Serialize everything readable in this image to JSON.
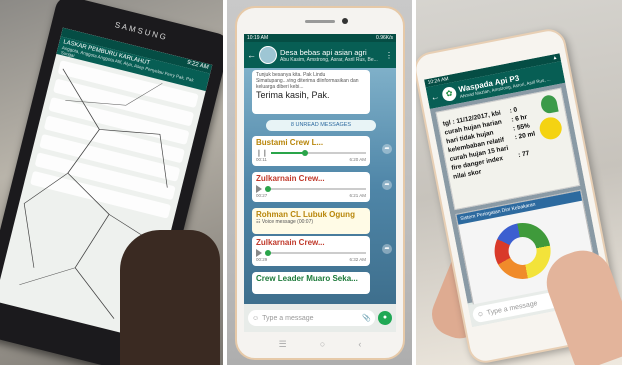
{
  "panel1": {
    "brand": "SAMSUNG",
    "header_title": "LASKAR PEMBURU KARLAHUT",
    "header_sub": "Anggota, Anggota Anggota Afif, Alya, Asep Penyelau Ferry Pak, Pak Sungai",
    "status_time": "9:22 AM"
  },
  "panel2": {
    "status_time": "10:19 AM",
    "status_right": "0.96K/s",
    "header_title": "Desa bebas api asian agri",
    "header_sub": "Abu Kasim, Amstrong, Asrar, Asril Rus, Be...",
    "intro_text": "Tunjuk besanya kita. Pak Lindu Simatupang...ving diterima diinformasikan dan keluarga diberi kebi...",
    "thanks_text": "Terima kasih, Pak.",
    "thanks_time": "12:27 PM",
    "unread": "8 UNREAD MESSAGES",
    "messages": [
      {
        "sender": "Bustami Crew L...",
        "t1": "00:11",
        "t2": "6:20 AM"
      },
      {
        "sender": "Zulkarnain Crew...",
        "t1": "00:27",
        "t2": "6:21 AM"
      },
      {
        "sender": "Rohman CL Lubuk Ogung",
        "text": "☷ Voice message (00:07)"
      },
      {
        "sender": "Zulkarnain Crew...",
        "t1": "00:29",
        "t2": "6:32 AM"
      },
      {
        "sender": "Crew Leader Muaro Seka...",
        "t1": "",
        "t2": ""
      }
    ],
    "input_placeholder": "Type a message"
  },
  "panel3": {
    "status_time": "10:24 AM",
    "header_title": "Waspada Api P3",
    "header_sub": "Ahmad Mazlan, Amstrong, Asrori, Asril Rus, ...",
    "rows": [
      {
        "label": "tgl : 11/12/2017, kbi",
        "value": ": 0"
      },
      {
        "label": "curah hujan harian",
        "value": ": 6 hr"
      },
      {
        "label": "hari tidak hujan",
        "value": ": 55%"
      },
      {
        "label": "kelembaban relatif",
        "value": ": 20 ml"
      },
      {
        "label": "curah hujan 15 hari",
        "value": ""
      },
      {
        "label": "fire danger index",
        "value": ": 77"
      },
      {
        "label": "nilai skor",
        "value": ""
      }
    ],
    "map_title": "Sistem Peringatan Dini Kebakaran",
    "input_placeholder": "Type a message"
  }
}
